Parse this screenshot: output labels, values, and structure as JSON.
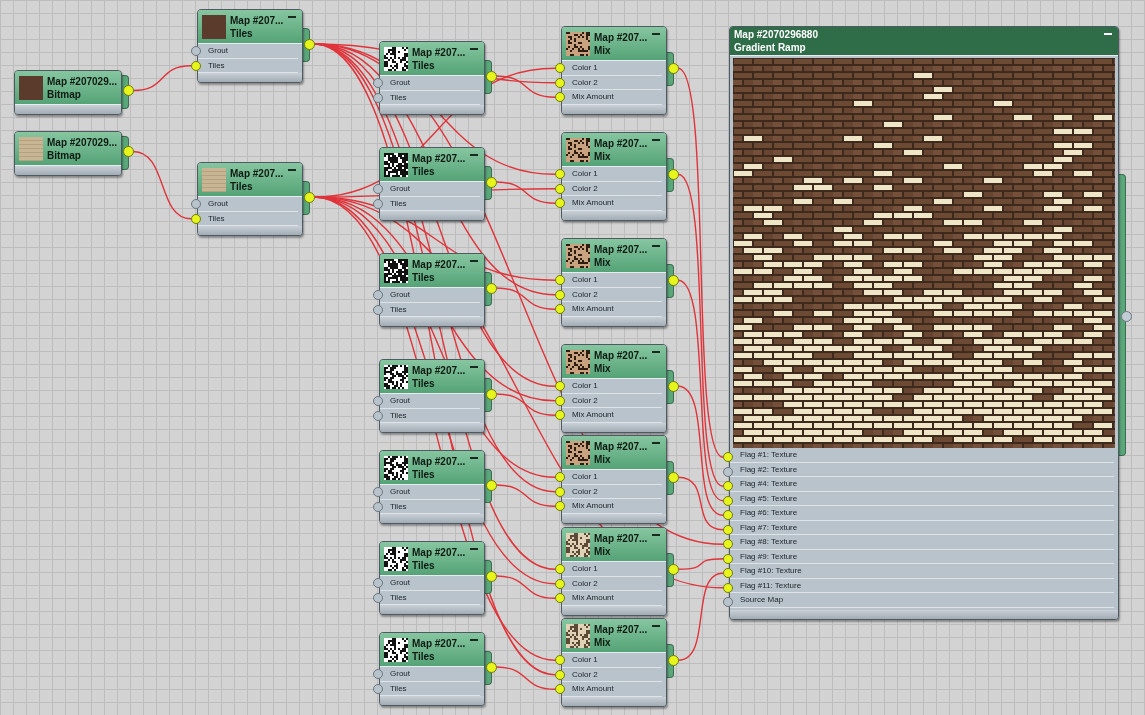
{
  "nodes": [
    {
      "kind": "bitmap",
      "title": "Map #207029...",
      "type": "Bitmap",
      "output_connected": true
    },
    {
      "kind": "bitmap",
      "title": "Map #207029...",
      "type": "Bitmap",
      "output_connected": true
    },
    {
      "kind": "map",
      "title": "Map #207...",
      "type": "Tiles",
      "output_connected": true,
      "ports": [
        {
          "label": "Grout",
          "connected": false
        },
        {
          "label": "Tiles",
          "connected": true
        }
      ]
    },
    {
      "kind": "map",
      "title": "Map #207...",
      "type": "Tiles",
      "output_connected": true,
      "ports": [
        {
          "label": "Grout",
          "connected": false
        },
        {
          "label": "Tiles",
          "connected": true
        }
      ]
    },
    {
      "kind": "map",
      "title": "Map #207...",
      "type": "Tiles",
      "output_connected": true,
      "ports": [
        {
          "label": "Grout",
          "connected": false
        },
        {
          "label": "Tiles",
          "connected": false
        }
      ]
    },
    {
      "kind": "map",
      "title": "Map #207...",
      "type": "Tiles",
      "output_connected": true,
      "ports": [
        {
          "label": "Grout",
          "connected": false
        },
        {
          "label": "Tiles",
          "connected": false
        }
      ]
    },
    {
      "kind": "map",
      "title": "Map #207...",
      "type": "Tiles",
      "output_connected": true,
      "ports": [
        {
          "label": "Grout",
          "connected": false
        },
        {
          "label": "Tiles",
          "connected": false
        }
      ]
    },
    {
      "kind": "map",
      "title": "Map #207...",
      "type": "Tiles",
      "output_connected": true,
      "ports": [
        {
          "label": "Grout",
          "connected": false
        },
        {
          "label": "Tiles",
          "connected": false
        }
      ]
    },
    {
      "kind": "map",
      "title": "Map #207...",
      "type": "Tiles",
      "output_connected": true,
      "ports": [
        {
          "label": "Grout",
          "connected": false
        },
        {
          "label": "Tiles",
          "connected": false
        }
      ]
    },
    {
      "kind": "map",
      "title": "Map #207...",
      "type": "Tiles",
      "output_connected": true,
      "ports": [
        {
          "label": "Grout",
          "connected": false
        },
        {
          "label": "Tiles",
          "connected": false
        }
      ]
    },
    {
      "kind": "map",
      "title": "Map #207...",
      "type": "Tiles",
      "output_connected": true,
      "ports": [
        {
          "label": "Grout",
          "connected": false
        },
        {
          "label": "Tiles",
          "connected": false
        }
      ]
    },
    {
      "kind": "map",
      "title": "Map #207...",
      "type": "Mix",
      "output_connected": true,
      "ports": [
        {
          "label": "Color 1",
          "connected": true
        },
        {
          "label": "Color 2",
          "connected": true
        },
        {
          "label": "Mix Amount",
          "connected": true
        }
      ]
    },
    {
      "kind": "map",
      "title": "Map #207...",
      "type": "Mix",
      "output_connected": true,
      "ports": [
        {
          "label": "Color 1",
          "connected": true
        },
        {
          "label": "Color 2",
          "connected": true
        },
        {
          "label": "Mix Amount",
          "connected": true
        }
      ]
    },
    {
      "kind": "map",
      "title": "Map #207...",
      "type": "Mix",
      "output_connected": true,
      "ports": [
        {
          "label": "Color 1",
          "connected": true
        },
        {
          "label": "Color 2",
          "connected": true
        },
        {
          "label": "Mix Amount",
          "connected": true
        }
      ]
    },
    {
      "kind": "map",
      "title": "Map #207...",
      "type": "Mix",
      "output_connected": true,
      "ports": [
        {
          "label": "Color 1",
          "connected": true
        },
        {
          "label": "Color 2",
          "connected": true
        },
        {
          "label": "Mix Amount",
          "connected": true
        }
      ]
    },
    {
      "kind": "map",
      "title": "Map #207...",
      "type": "Mix",
      "output_connected": true,
      "ports": [
        {
          "label": "Color 1",
          "connected": true
        },
        {
          "label": "Color 2",
          "connected": true
        },
        {
          "label": "Mix Amount",
          "connected": true
        }
      ]
    },
    {
      "kind": "map",
      "title": "Map #207...",
      "type": "Mix",
      "output_connected": true,
      "ports": [
        {
          "label": "Color 1",
          "connected": true
        },
        {
          "label": "Color 2",
          "connected": true
        },
        {
          "label": "Mix Amount",
          "connected": true
        }
      ]
    },
    {
      "kind": "map",
      "title": "Map #207...",
      "type": "Mix",
      "output_connected": true,
      "ports": [
        {
          "label": "Color 1",
          "connected": true
        },
        {
          "label": "Color 2",
          "connected": true
        },
        {
          "label": "Mix Amount",
          "connected": true
        }
      ]
    },
    {
      "kind": "gradient",
      "title": "Map #2070296880",
      "type": "Gradient Ramp",
      "output_connected": false,
      "ports": [
        {
          "label": "Flag #1: Texture",
          "connected": true
        },
        {
          "label": "Flag #2: Texture",
          "connected": false
        },
        {
          "label": "Flag #4: Texture",
          "connected": true
        },
        {
          "label": "Flag #5: Texture",
          "connected": true
        },
        {
          "label": "Flag #6: Texture",
          "connected": true
        },
        {
          "label": "Flag #7: Texture",
          "connected": true
        },
        {
          "label": "Flag #8: Texture",
          "connected": true
        },
        {
          "label": "Flag #9: Texture",
          "connected": true
        },
        {
          "label": "Flag #10: Texture",
          "connected": true
        },
        {
          "label": "Flag #11: Texture",
          "connected": true
        },
        {
          "label": "Source Map",
          "connected": false
        }
      ]
    }
  ]
}
